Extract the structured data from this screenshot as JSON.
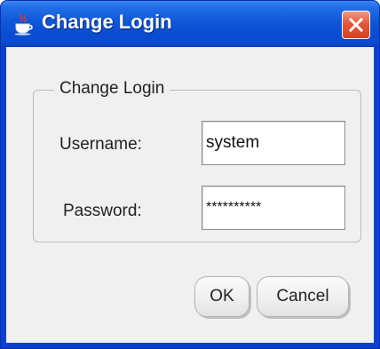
{
  "window": {
    "title": "Change Login",
    "icon": "java-cup-icon"
  },
  "form": {
    "group_label": "Change Login",
    "username_label": "Username:",
    "username_value": "system",
    "password_label": "Password:",
    "password_value": "**********"
  },
  "buttons": {
    "ok_label": "OK",
    "cancel_label": "Cancel"
  },
  "colors": {
    "titlebar": "#0a4dd1",
    "close_button": "#e2573a",
    "panel": "#f0f0f0"
  }
}
